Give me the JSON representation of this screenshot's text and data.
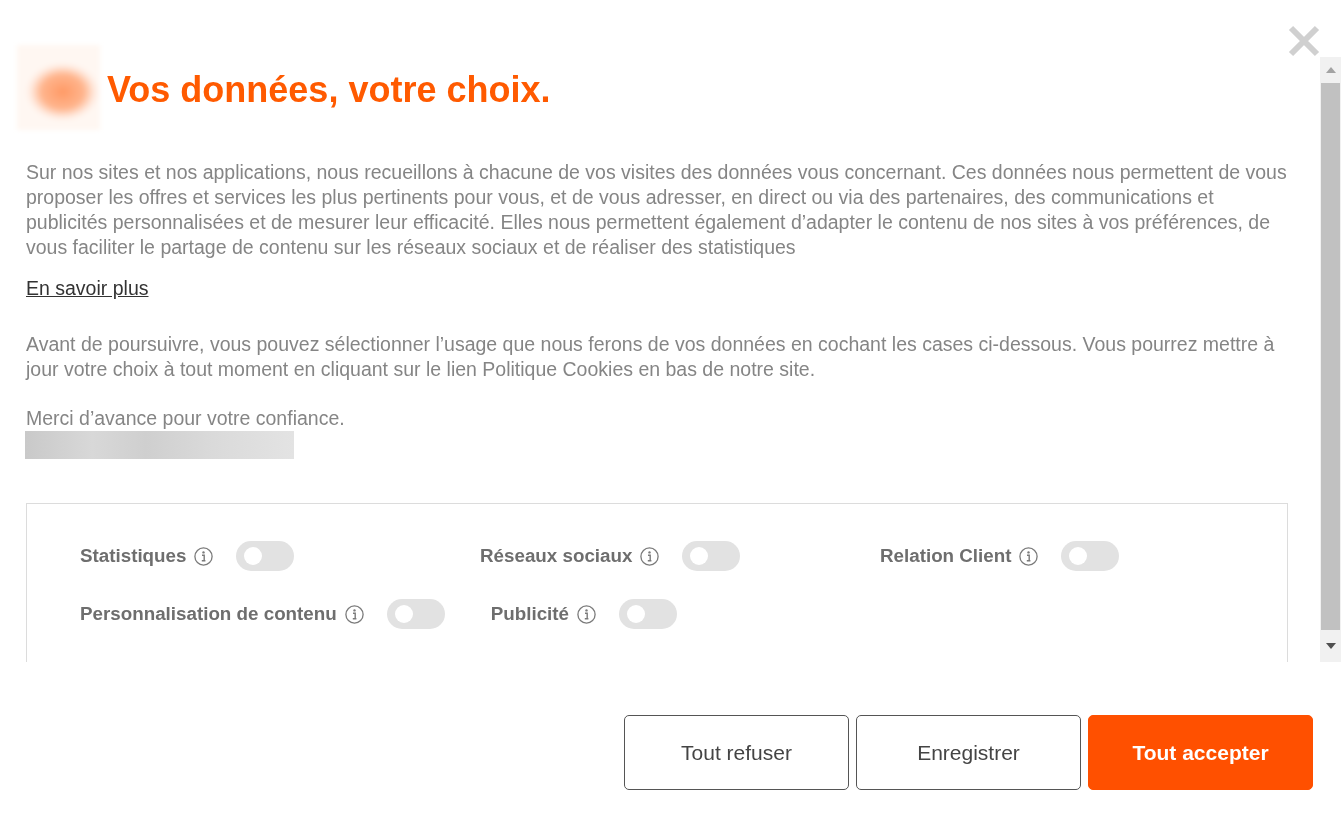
{
  "header": {
    "title": "Vos données, votre choix."
  },
  "intro": {
    "paragraph": "Sur nos sites et nos applications, nous recueillons à chacune de vos visites des données vous concernant. Ces données nous permettent de vous proposer les offres et services les plus pertinents pour vous, et de vous adresser, en direct ou via des partenaires, des communications et publicités personnalisées et de mesurer leur efficacité. Elles nous permettent également d’adapter le contenu de nos sites à vos préférences, de vous faciliter le partage de contenu sur les réseaux sociaux et de réaliser des statistiques",
    "link": "En savoir plus",
    "instructions": "Avant de poursuivre, vous pouvez sélectionner l’usage que nous ferons de vos données en cochant les cases ci-dessous. Vous pourrez mettre à jour votre choix à tout moment en cliquant sur le lien Politique Cookies en bas de notre site.",
    "closing": "Merci d’avance pour votre confiance."
  },
  "consent_options": [
    {
      "label": "Statistiques",
      "on": false
    },
    {
      "label": "Réseaux sociaux",
      "on": false
    },
    {
      "label": "Relation Client",
      "on": false
    },
    {
      "label": "Personnalisation de contenu",
      "on": false
    },
    {
      "label": "Publicité",
      "on": false
    }
  ],
  "buttons": [
    {
      "label": "Tout refuser",
      "kind": "secondary"
    },
    {
      "label": "Enregistrer",
      "kind": "secondary"
    },
    {
      "label": "Tout accepter",
      "kind": "primary"
    }
  ]
}
